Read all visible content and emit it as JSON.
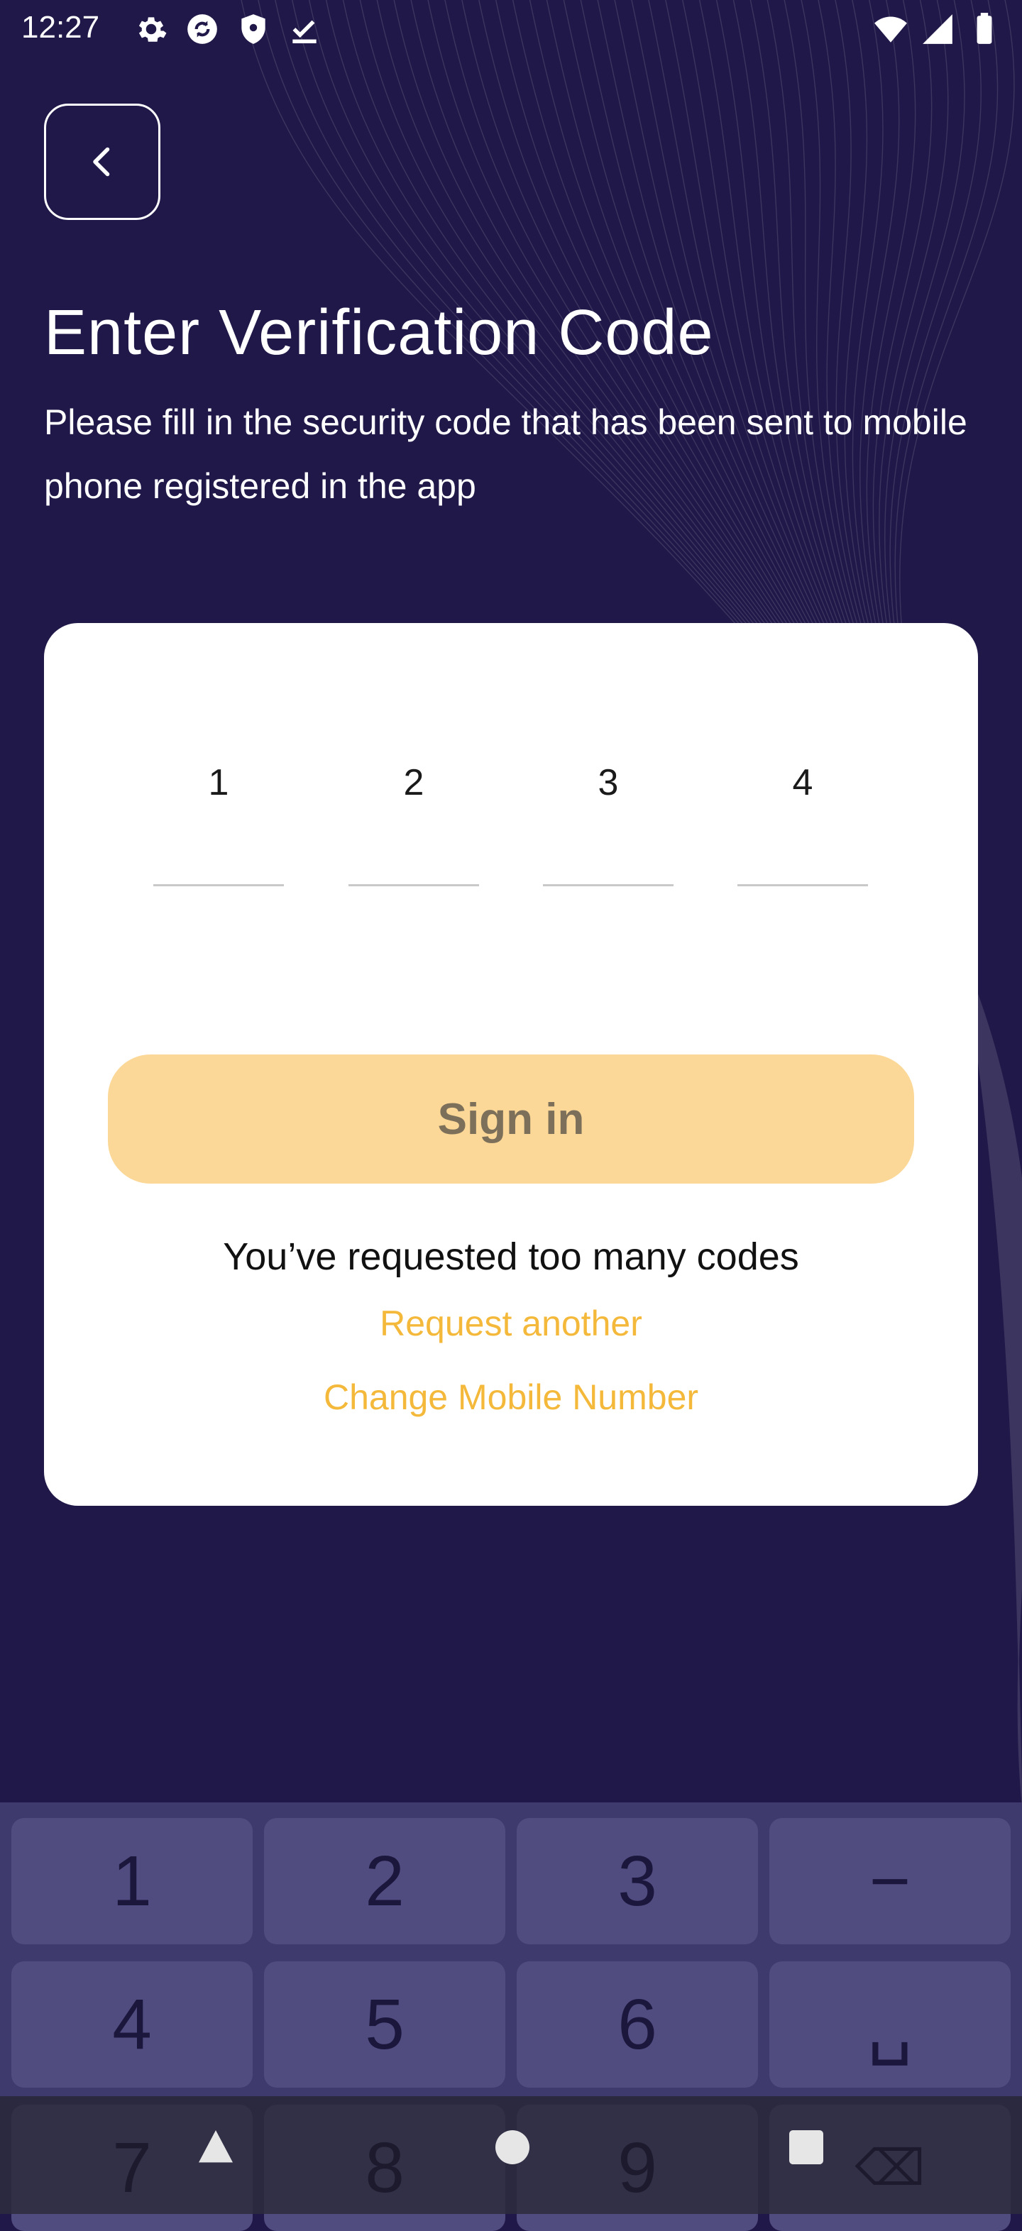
{
  "status_bar": {
    "time": "12:27",
    "left_icons": [
      "settings-icon",
      "sync-icon",
      "shield-icon",
      "download-done-icon"
    ],
    "right_icons": [
      "wifi-icon",
      "signal-icon",
      "battery-icon"
    ]
  },
  "header": {
    "back_icon": "chevron-left-icon",
    "title": "Enter Verification Code",
    "subtitle": "Please fill in the security code that has been sent to mobile phone registered in the app"
  },
  "card": {
    "code_digits": [
      "1",
      "2",
      "3",
      "4"
    ],
    "sign_in_label": "Sign in",
    "too_many_codes_text": "You’ve requested too many codes",
    "request_another_label": "Request another",
    "change_number_label": "Change Mobile Number"
  },
  "keyboard": {
    "keys": [
      "1",
      "2",
      "3",
      "−",
      "4",
      "5",
      "6",
      "␣",
      "7",
      "8",
      "9",
      "⌫"
    ]
  },
  "colors": {
    "background": "#201848",
    "card": "#ffffff",
    "button": "#fbd897",
    "link": "#f4b93a",
    "keyboard": "#3e3a6e"
  }
}
